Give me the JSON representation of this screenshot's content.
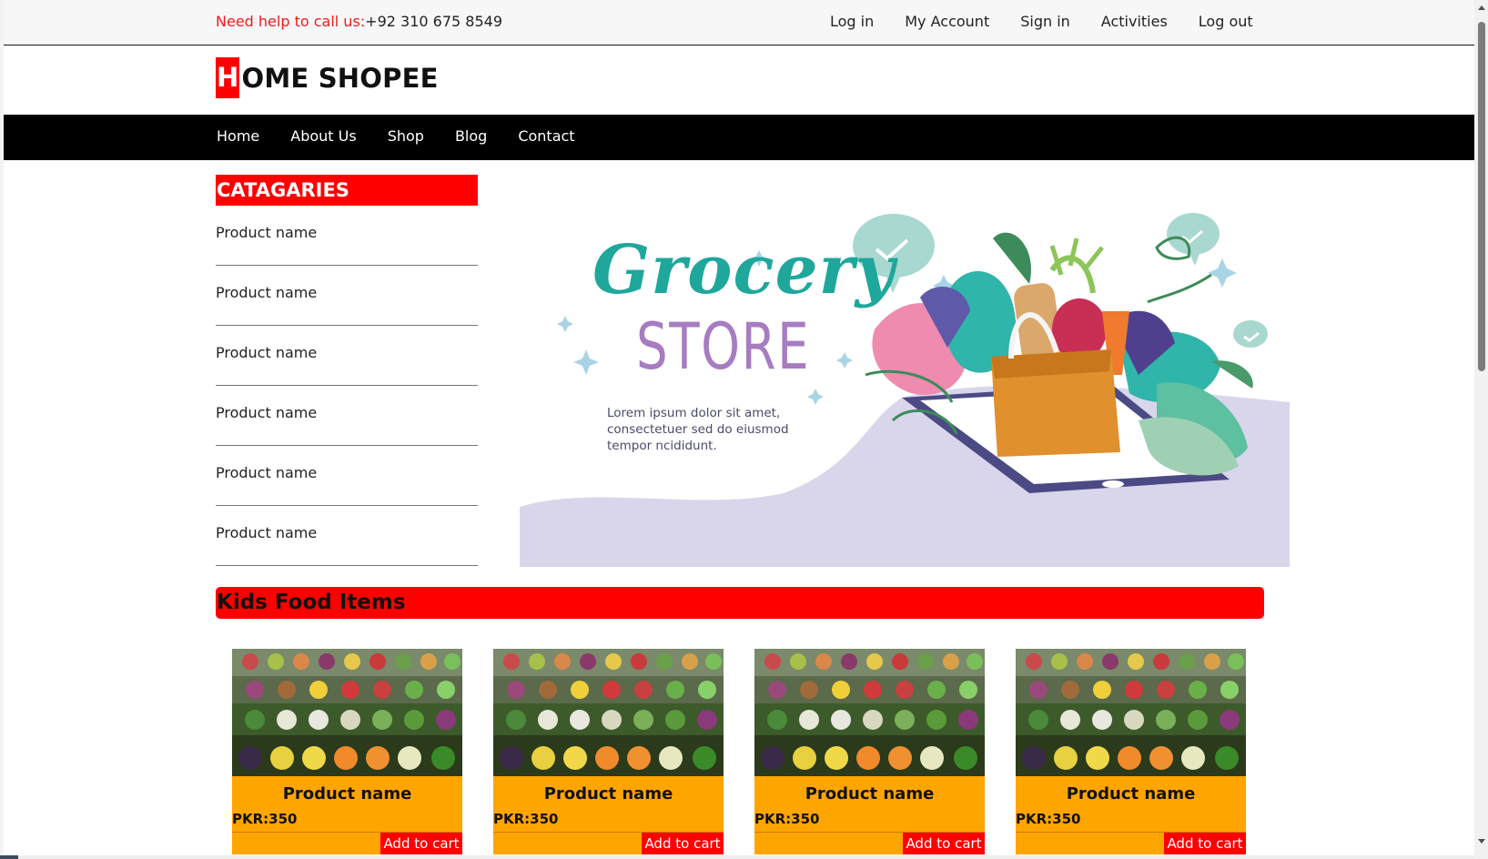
{
  "header": {
    "help_label": "Need help to call us:",
    "phone": "+92 310 675 8549",
    "links": [
      "Log in",
      "My Account",
      "Sign in",
      "Activities",
      "Log out"
    ]
  },
  "logo": {
    "initial": "H",
    "rest": "OME SHOPEE"
  },
  "nav": {
    "items": [
      "Home",
      "About Us",
      "Shop",
      "Blog",
      "Contact"
    ]
  },
  "categories": {
    "title": "CATAGARIES",
    "items": [
      "Product name",
      "Product name",
      "Product name",
      "Product name",
      "Product name",
      "Product name"
    ]
  },
  "hero": {
    "title_script": "Grocery",
    "title_caps": "STORE",
    "text_lines": [
      "Lorem ipsum dolor sit amet,",
      "consectetuer sed do eiusmod",
      "tempor ncididunt."
    ]
  },
  "section": {
    "title": "Kids Food Items"
  },
  "products": [
    {
      "name": "Product name",
      "price": "PKR:350",
      "cart_label": "Add to cart"
    },
    {
      "name": "Product name",
      "price": "PKR:350",
      "cart_label": "Add to cart"
    },
    {
      "name": "Product name",
      "price": "PKR:350",
      "cart_label": "Add to cart"
    },
    {
      "name": "Product name",
      "price": "PKR:350",
      "cart_label": "Add to cart"
    }
  ],
  "colors": {
    "accent": "#ff0000",
    "card": "#ffa500",
    "nav": "#000000",
    "hero_ground": "#d9d6ec"
  }
}
